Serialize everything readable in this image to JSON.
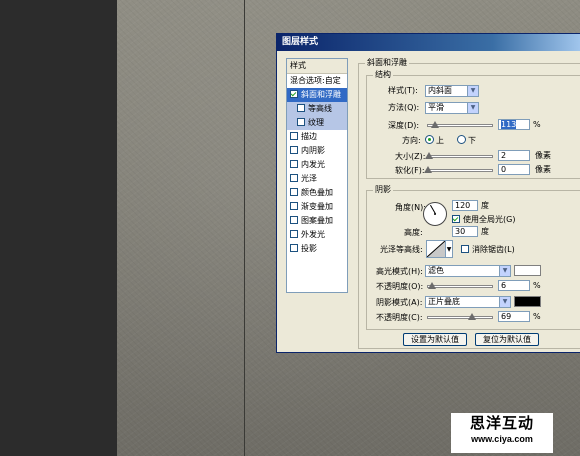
{
  "dialog": {
    "title": "图层样式"
  },
  "styles_list": {
    "header": "样式",
    "blend_options": "混合选项:自定",
    "items": [
      {
        "label": "斜面和浮雕",
        "checked": true
      },
      {
        "label": "等高线",
        "checked": false
      },
      {
        "label": "纹理",
        "checked": false
      },
      {
        "label": "描边",
        "checked": false
      },
      {
        "label": "内阴影",
        "checked": false
      },
      {
        "label": "内发光",
        "checked": false
      },
      {
        "label": "光泽",
        "checked": false
      },
      {
        "label": "颜色叠加",
        "checked": false
      },
      {
        "label": "渐变叠加",
        "checked": false
      },
      {
        "label": "图案叠加",
        "checked": false
      },
      {
        "label": "外发光",
        "checked": false
      },
      {
        "label": "投影",
        "checked": false
      }
    ]
  },
  "bevel": {
    "group_title": "斜面和浮雕",
    "structure_title": "结构",
    "style_label": "样式(T):",
    "style_value": "内斜面",
    "technique_label": "方法(Q):",
    "technique_value": "平滑",
    "depth_label": "深度(D):",
    "depth_value": "113",
    "depth_unit": "%",
    "depth_slider": 0.113,
    "direction_label": "方向:",
    "direction_up": "上",
    "direction_down": "下",
    "size_label": "大小(Z):",
    "size_value": "2",
    "size_unit": "像素",
    "size_slider": 0.02,
    "soften_label": "软化(F):",
    "soften_value": "0",
    "soften_unit": "像素",
    "soften_slider": 0
  },
  "shading": {
    "title": "阴影",
    "angle_label": "角度(N):",
    "angle_value": "120",
    "angle_unit": "度",
    "global_light_label": "使用全局光(G)",
    "global_light_checked": true,
    "altitude_label": "高度:",
    "altitude_value": "30",
    "altitude_unit": "度",
    "gloss_label": "光泽等高线:",
    "antialias_label": "消除锯齿(L)",
    "antialias_checked": false,
    "highlight_mode_label": "高光模式(H):",
    "highlight_mode_value": "滤色",
    "highlight_color": "#ffffff",
    "highlight_opacity_label": "不透明度(O):",
    "highlight_opacity_value": "6",
    "highlight_opacity_unit": "%",
    "highlight_opacity_slider": 0.06,
    "shadow_mode_label": "阴影模式(A):",
    "shadow_mode_value": "正片叠底",
    "shadow_color": "#000000",
    "shadow_opacity_label": "不透明度(C):",
    "shadow_opacity_value": "69",
    "shadow_opacity_unit": "%",
    "shadow_opacity_slider": 0.69
  },
  "buttons": {
    "make_default": "设置为默认值",
    "reset_default": "复位为默认值"
  },
  "watermark": {
    "title": "思洋互动",
    "url": "www.ciya.com"
  },
  "colors": {
    "titlebar": "#0a246a",
    "selection": "#316ac5",
    "dialog_bg": "#ece9d8"
  }
}
